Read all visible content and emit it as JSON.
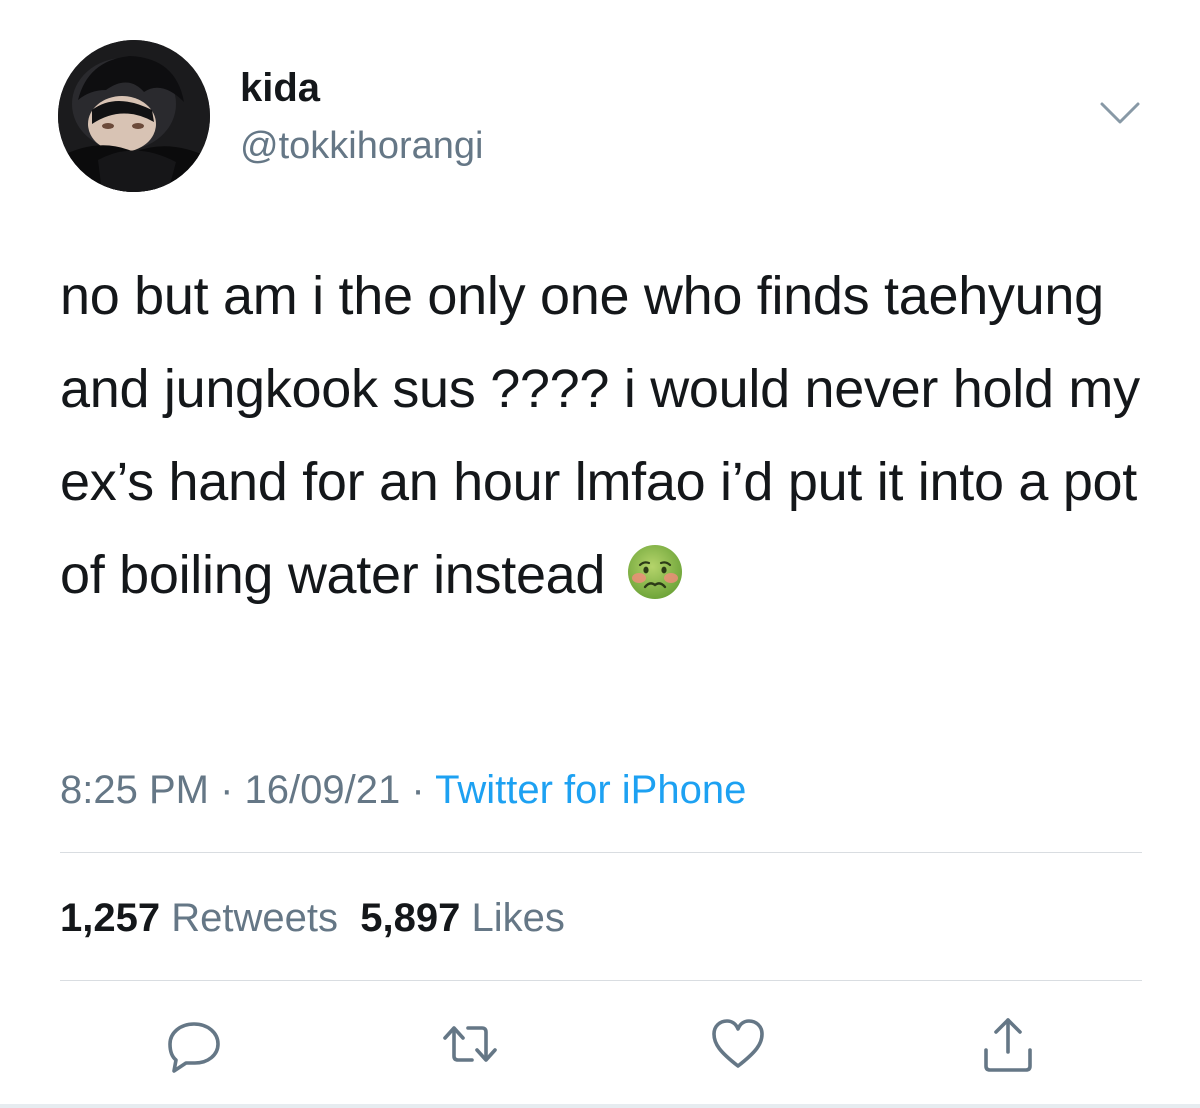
{
  "user": {
    "display_name": "kida",
    "handle": "@tokkihorangi"
  },
  "tweet": {
    "text": "no but am i the only one who finds taehyung and jungkook sus ???? i would never hold my ex’s hand for an hour lmfao i’d put it into a pot of boiling water instead",
    "emoji": "nauseated-face-emoji"
  },
  "meta": {
    "time": "8:25 PM",
    "separator": "·",
    "date": "16/09/21",
    "source": "Twitter for iPhone"
  },
  "stats": {
    "retweets_count": "1,257",
    "retweets_label": "Retweets",
    "likes_count": "5,897",
    "likes_label": "Likes"
  },
  "icons": {
    "reply": "reply-icon",
    "retweet": "retweet-icon",
    "like": "heart-icon",
    "share": "share-icon",
    "menu": "chevron-down-icon"
  },
  "colors": {
    "text": "#14171a",
    "secondary": "#657786",
    "link": "#1da1f2",
    "divider": "#d9dde1"
  }
}
